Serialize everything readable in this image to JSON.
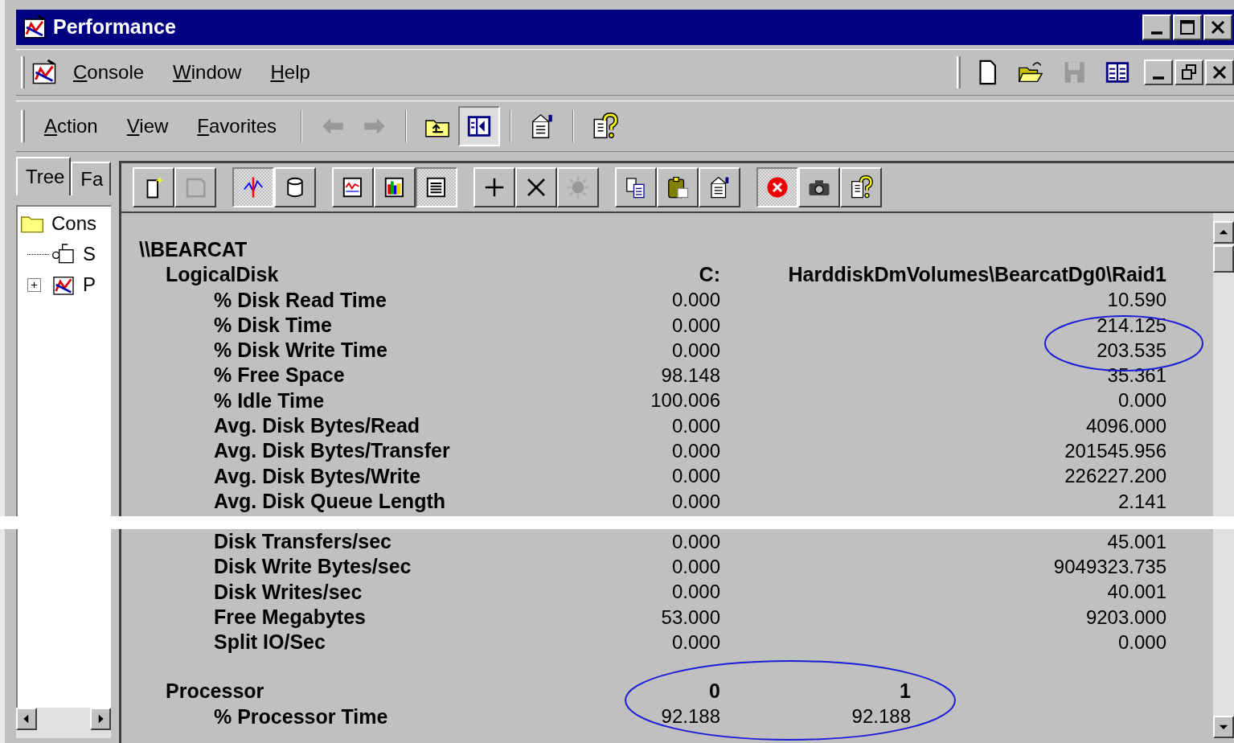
{
  "window": {
    "title": "Performance"
  },
  "menu_bar": {
    "menus": [
      "Console",
      "Window",
      "Help"
    ],
    "tools": [
      {
        "kind": "page",
        "disabled": false
      },
      {
        "kind": "open",
        "disabled": false
      },
      {
        "kind": "save",
        "disabled": true
      },
      {
        "kind": "details",
        "disabled": false
      }
    ]
  },
  "action_bar": {
    "menus": [
      "Action",
      "View",
      "Favorites"
    ],
    "groups": [
      {
        "tools": [
          {
            "kind": "back",
            "disabled": true,
            "pressed": false
          },
          {
            "kind": "forward",
            "disabled": true,
            "pressed": false
          }
        ]
      },
      {
        "tools": [
          {
            "kind": "up",
            "disabled": false,
            "pressed": false
          },
          {
            "kind": "pane",
            "disabled": false,
            "pressed": true
          }
        ]
      },
      {
        "tools": [
          {
            "kind": "properties",
            "disabled": false,
            "pressed": false
          }
        ]
      },
      {
        "tools": [
          {
            "kind": "help",
            "disabled": false,
            "pressed": false
          }
        ]
      }
    ]
  },
  "tabs": [
    {
      "label": "Tree",
      "selected": true
    },
    {
      "label": "Fa",
      "selected": false
    }
  ],
  "tree": [
    {
      "label": "Cons",
      "kind": "folder",
      "children": [
        {
          "label": "S",
          "kind": "leaf"
        },
        {
          "label": "P",
          "kind": "collapsed"
        }
      ]
    }
  ],
  "panel_toolbar": [
    {
      "buttons": [
        {
          "kind": "new_set",
          "pressed": false,
          "disabled": false
        },
        {
          "kind": "clear",
          "pressed": false,
          "disabled": true
        }
      ]
    },
    {
      "buttons": [
        {
          "kind": "current",
          "pressed": true,
          "disabled": false
        },
        {
          "kind": "cylinder",
          "pressed": false,
          "disabled": false
        }
      ]
    },
    {
      "buttons": [
        {
          "kind": "graph",
          "pressed": false,
          "disabled": false
        },
        {
          "kind": "histogram",
          "pressed": false,
          "disabled": false
        },
        {
          "kind": "report",
          "pressed": true,
          "disabled": false
        }
      ]
    },
    {
      "buttons": [
        {
          "kind": "plus",
          "pressed": false,
          "disabled": false
        },
        {
          "kind": "cross",
          "pressed": false,
          "disabled": false
        },
        {
          "kind": "highlight",
          "pressed": false,
          "disabled": true
        }
      ]
    },
    {
      "buttons": [
        {
          "kind": "copy",
          "pressed": false,
          "disabled": false
        },
        {
          "kind": "paste",
          "pressed": false,
          "disabled": false
        },
        {
          "kind": "properties",
          "pressed": false,
          "disabled": false
        }
      ]
    },
    {
      "buttons": [
        {
          "kind": "freeze",
          "pressed": true,
          "disabled": false
        },
        {
          "kind": "camera",
          "pressed": false,
          "disabled": false
        },
        {
          "kind": "help",
          "pressed": false,
          "disabled": false
        }
      ]
    }
  ],
  "report": {
    "host": "\\\\BEARCAT",
    "sections": [
      {
        "kind": "wide",
        "object": "LogicalDisk",
        "instances": [
          "C:",
          "HarddiskDmVolumes\\BearcatDg0\\Raid1"
        ],
        "counters": [
          {
            "name": "% Disk Read Time",
            "values": [
              "0.000",
              "10.590"
            ],
            "torn_before": false
          },
          {
            "name": "% Disk Time",
            "values": [
              "0.000",
              "214.125"
            ],
            "torn_before": false
          },
          {
            "name": "% Disk Write Time",
            "values": [
              "0.000",
              "203.535"
            ],
            "torn_before": false
          },
          {
            "name": "% Free Space",
            "values": [
              "98.148",
              "35.361"
            ],
            "torn_before": false
          },
          {
            "name": "% Idle Time",
            "values": [
              "100.006",
              "0.000"
            ],
            "torn_before": false
          },
          {
            "name": "Avg. Disk Bytes/Read",
            "values": [
              "0.000",
              "4096.000"
            ],
            "torn_before": false
          },
          {
            "name": "Avg. Disk Bytes/Transfer",
            "values": [
              "0.000",
              "201545.956"
            ],
            "torn_before": false
          },
          {
            "name": "Avg. Disk Bytes/Write",
            "values": [
              "0.000",
              "226227.200"
            ],
            "torn_before": false
          },
          {
            "name": "Avg. Disk Queue Length",
            "values": [
              "0.000",
              "2.141"
            ],
            "torn_before": false
          },
          {
            "name": "Disk Transfers/sec",
            "values": [
              "0.000",
              "45.001"
            ],
            "torn_before": true
          },
          {
            "name": "Disk Write Bytes/sec",
            "values": [
              "0.000",
              "9049323.735"
            ],
            "torn_before": false
          },
          {
            "name": "Disk Writes/sec",
            "values": [
              "0.000",
              "40.001"
            ],
            "torn_before": false
          },
          {
            "name": "Free Megabytes",
            "values": [
              "53.000",
              "9203.000"
            ],
            "torn_before": false
          },
          {
            "name": "Split IO/Sec",
            "values": [
              "0.000",
              "0.000"
            ],
            "torn_before": false
          }
        ]
      },
      {
        "kind": "narrow",
        "object": "Processor",
        "instances": [
          "0",
          "1"
        ],
        "counters": [
          {
            "name": "% Processor Time",
            "values": [
              "92.188",
              "92.188"
            ],
            "torn_before": false
          }
        ]
      }
    ]
  }
}
